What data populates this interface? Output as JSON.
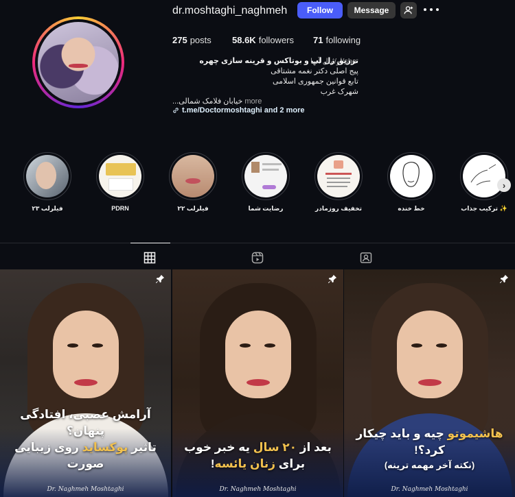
{
  "profile": {
    "username": "dr.moshtaghi_naghmeh",
    "follow_label": "Follow",
    "message_label": "Message",
    "posts_count": "275",
    "posts_label": "posts",
    "followers_count": "58.6K",
    "followers_label": "followers",
    "following_count": "71",
    "following_label": "following",
    "bio_name": "تزریق ژل لب و بوتاکس و قرینه سازی چهره",
    "pronouns": "او/مال آنها/she",
    "bio_line1": "پیج اصلی دکتر نغمه مشتاقی",
    "bio_line2": "تابع قوانین جمهوری اسلامی",
    "bio_line3": "شهرک غرب",
    "bio_line4": "...خیابان فلامک شمالی",
    "more_label": "more",
    "link_text": "t.me/Doctormoshtaghi and 2 more"
  },
  "highlights": [
    {
      "label": "فیلرلب ۲۳"
    },
    {
      "label": "PDRN"
    },
    {
      "label": "فیلرلب ۲۲"
    },
    {
      "label": "رضایت شما"
    },
    {
      "label": "تخفیف روزمادر"
    },
    {
      "label": "خط خنده"
    },
    {
      "label": "ترکیب جذاب ✨"
    }
  ],
  "tabs": {
    "active": "posts"
  },
  "posts": [
    {
      "line1": "آرامش عصبی، افتادگی پنهان؟",
      "line2_a": "تاثیر ",
      "line2_b": "پوکساید",
      "line2_c": " روی زیبایی صورت",
      "signature": "Dr. Naghmeh Moshtaghi"
    },
    {
      "line1_a": "بعد از ",
      "line1_b": "۲۰ سال",
      "line1_c": " یه خبر خوب",
      "line2_a": "برای ",
      "line2_b": "زنان یائسه",
      "line2_c": "!",
      "signature": "Dr. Naghmeh Moshtaghi"
    },
    {
      "line1_a": "هاشیموتو",
      "line1_b": " چیه و باید چیکار کرد؟!",
      "line2": "(نکته آخر مهمه ترینه)",
      "signature": "Dr. Naghmeh Moshtaghi"
    }
  ],
  "colors": {
    "follow": "#4a5df9",
    "secondary_button": "#363636",
    "background": "#0b0d13",
    "caption_highlight": "#f2c14e"
  }
}
